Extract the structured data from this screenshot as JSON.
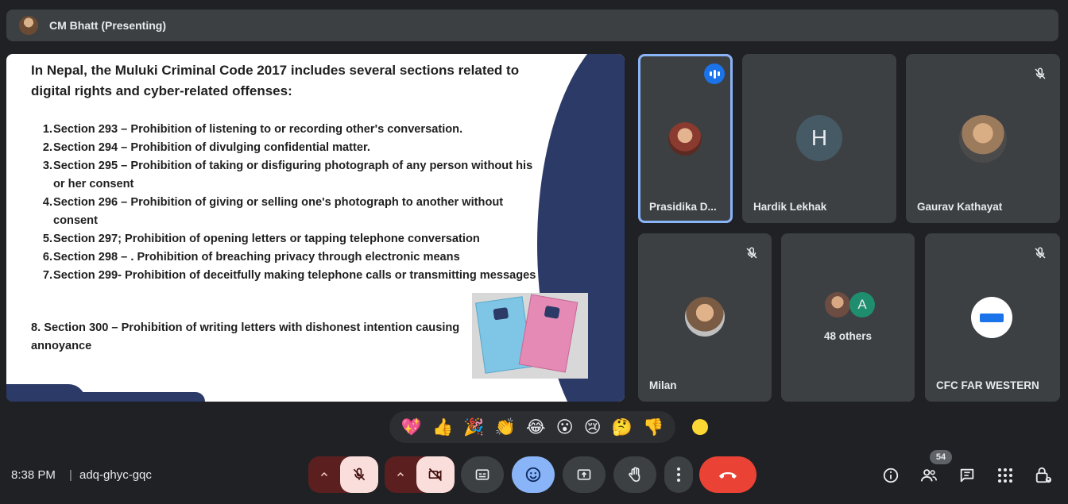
{
  "presenter": {
    "name": "CM Bhatt (Presenting)"
  },
  "slide": {
    "title": "In Nepal, the Muluki Criminal Code 2017 includes several sections related to digital rights and cyber-related offenses:",
    "items": [
      {
        "num": "1.",
        "text": "Section 293 – Prohibition of listening to or recording other's conversation."
      },
      {
        "num": "2.",
        "text": "Section 294 – Prohibition of divulging confidential matter."
      },
      {
        "num": "3.",
        "text": "Section 295 – Prohibition of taking or disfiguring photograph of any person without his or her consent"
      },
      {
        "num": "4.",
        "text": "Section 296 – Prohibition of giving or selling one's photograph to another without consent"
      },
      {
        "num": "5.",
        "text": "Section 297; Prohibition of opening letters or tapping telephone conversation"
      },
      {
        "num": "6.",
        "text": "Section 298 – . Prohibition of breaching privacy through electronic means"
      },
      {
        "num": "7.",
        "text": "Section 299- Prohibition of deceitfully making telephone calls or transmitting messages"
      }
    ],
    "last_item": "8. Section 300 – Prohibition of writing letters with dishonest intention causing annoyance"
  },
  "participants": {
    "prasidika": {
      "name": "Prasidika D..."
    },
    "hardik": {
      "name": "Hardik Lekhak",
      "initial": "H"
    },
    "gaurav": {
      "name": "Gaurav Kathayat"
    },
    "milan": {
      "name": "Milan"
    },
    "others": {
      "initial": "A",
      "label": "48 others"
    },
    "cfc": {
      "name": "CFC FAR WESTERN"
    }
  },
  "reactions": [
    "💖",
    "👍",
    "🎉",
    "👏",
    "😂",
    "😮",
    "😢",
    "🤔",
    "👎"
  ],
  "meeting": {
    "time": "8:38 PM",
    "separator": "|",
    "code": "adq-ghyc-gqc",
    "participant_count": "54"
  },
  "colors": {
    "background": "#202124",
    "tile": "#3c4043",
    "accent": "#8ab4f8",
    "end_call": "#ea4335",
    "slide_dark": "#2b3a67"
  }
}
